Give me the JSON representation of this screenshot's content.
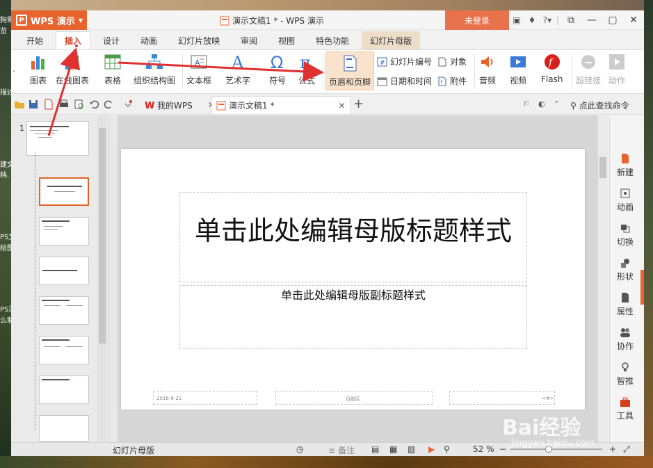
{
  "app": {
    "name": "WPS 演示",
    "doc_title": "演示文稿1 * - WPS 演示",
    "login": "未登录"
  },
  "menu": [
    "开始",
    "插入",
    "设计",
    "动画",
    "幻灯片放映",
    "审阅",
    "视图",
    "特色功能",
    "幻灯片母版"
  ],
  "ribbon": {
    "picture": "图表",
    "online_chart": "在线图表",
    "table": "表格",
    "org_chart": "组织结构图",
    "textbox": "文本框",
    "wordart": "艺术字",
    "symbol": "符号",
    "formula": "公式",
    "header_footer": "页眉和页脚",
    "slide_number": "幻灯片编号",
    "date_time": "日期和时间",
    "object": "对象",
    "attachment": "附件",
    "audio": "音频",
    "video": "视频",
    "flash": "Flash",
    "hyperlink": "超链接",
    "action": "动作"
  },
  "tabs": {
    "wps": "我的WPS",
    "doc": "演示文稿1 *",
    "search": "点此查找命令"
  },
  "thumbs": {
    "slide_number": "1"
  },
  "slide": {
    "title": "单击此处编辑母版标题样式",
    "subtitle": "单击此处编辑母版副标题样式",
    "footer_date": "2016-9-21",
    "footer_center": "页脚区",
    "footer_num": "<#>"
  },
  "right_panel": [
    "新建",
    "动画",
    "切换",
    "形状",
    "属性",
    "协作",
    "智推",
    "工具"
  ],
  "status": {
    "mode": "幻灯片母版",
    "notes": "备注",
    "zoom": "52 %"
  },
  "desktop": {
    "labels": [
      "狗需",
      "览",
      "描述",
      "建文",
      "档.",
      "PS文",
      "绘图",
      "PS演",
      "么制"
    ]
  },
  "watermark": {
    "main": "Bai经验",
    "url": "jingyan.baidu.com"
  },
  "colors": {
    "accent": "#e8642c",
    "annotation": "#e03030"
  }
}
